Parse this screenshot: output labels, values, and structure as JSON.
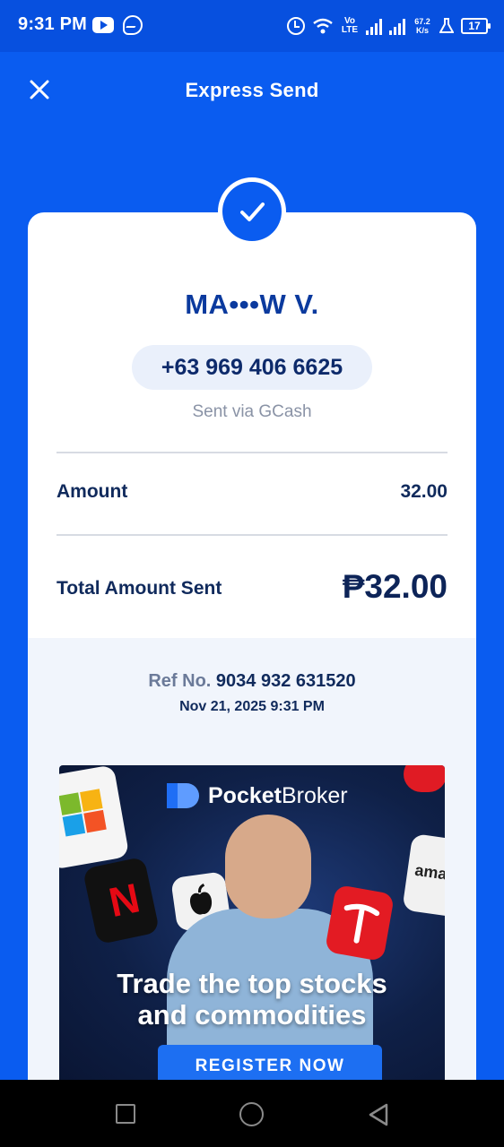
{
  "status_bar": {
    "time": "9:31 PM",
    "volte": "Vo LTE",
    "net_speed": "67.2 K/s",
    "battery": "17"
  },
  "header": {
    "title": "Express Send"
  },
  "receipt": {
    "recipient_name": "MA•••W V.",
    "phone": "+63 969 406 6625",
    "sent_via": "Sent via GCash",
    "amount_label": "Amount",
    "amount_value": "32.00",
    "total_label": "Total Amount Sent",
    "total_value": "₱32.00",
    "ref_label": "Ref No.",
    "ref_number": "9034 932 631520",
    "datetime": "Nov 21, 2025 9:31 PM"
  },
  "ad": {
    "brand_bold": "Pocket",
    "brand_light": "Broker",
    "headline_line1": "Trade the top stocks",
    "headline_line2": "and commodities",
    "cta": "REGISTER NOW",
    "tile_text_amazon": "ama"
  },
  "colors": {
    "primary": "#0a5cf0",
    "text_dark": "#102a5c"
  }
}
